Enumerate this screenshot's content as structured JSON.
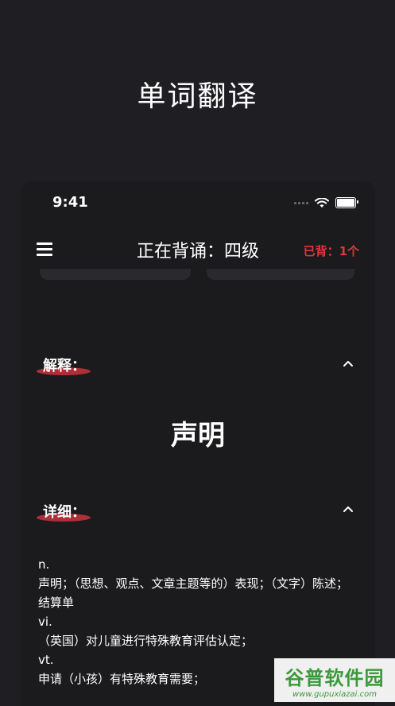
{
  "promo": {
    "title": "单词翻译"
  },
  "status_bar": {
    "time": "9:41"
  },
  "nav": {
    "title": "正在背诵：四级",
    "count_label": "已背：1个"
  },
  "explanation": {
    "label": "解释：",
    "word": "声明"
  },
  "detail": {
    "label": "详细：",
    "lines": [
      "n.",
      "声明；（思想、观点、文章主题等的）表现；（文字）陈述；结算单",
      "vi.",
      "（英国）对儿童进行特殊教育评估认定；",
      "vt.",
      "申请（小孩）有特殊教育需要；"
    ]
  },
  "watermark": {
    "main": "谷普软件园",
    "url": "www.gupuxiazai.com"
  },
  "colors": {
    "accent": "#e0363d",
    "underline": "#b5303a",
    "background": "#1f1f23"
  }
}
